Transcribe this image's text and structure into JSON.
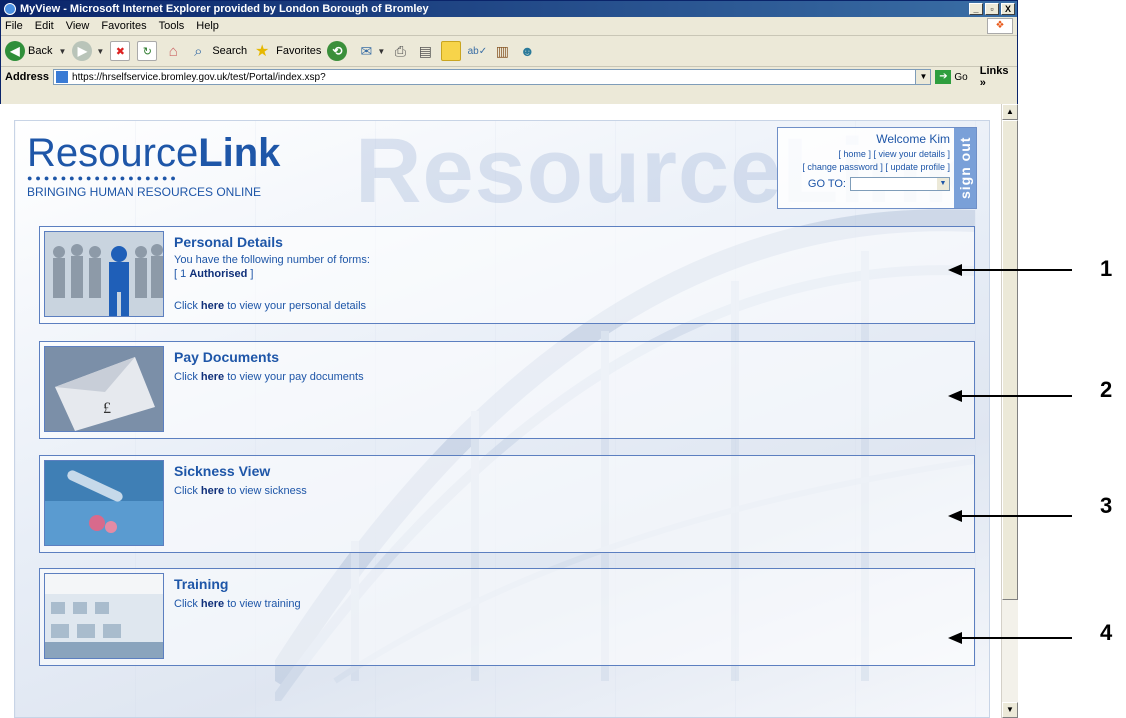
{
  "window": {
    "title": "MyView - Microsoft Internet Explorer provided by London Borough of Bromley",
    "min": "_",
    "max": "▫",
    "close": "X"
  },
  "menu": [
    "File",
    "Edit",
    "View",
    "Favorites",
    "Tools",
    "Help"
  ],
  "toolbar": {
    "back": "Back",
    "search": "Search",
    "favorites": "Favorites"
  },
  "address": {
    "label": "Address",
    "url": "https://hrselfservice.bromley.gov.uk/test/Portal/index.xsp?",
    "go": "Go",
    "links": "Links"
  },
  "header": {
    "watermark": "ResourceLink",
    "logo_text_a": "Resource",
    "logo_text_b": "Link",
    "tagline": "BRINGING HUMAN RESOURCES ONLINE"
  },
  "userbox": {
    "welcome": "Welcome Kim",
    "home": "home",
    "view_details": "view your details",
    "change_password": "change password",
    "update_profile": "update profile",
    "goto_label": "GO TO:",
    "signout": "sign out"
  },
  "panels": [
    {
      "title": "Personal Details",
      "line1": "You have the following number of forms:",
      "forms_count": "1",
      "forms_status": "Authorised",
      "click": "Click",
      "here": "here",
      "tail": "to view your personal details"
    },
    {
      "title": "Pay Documents",
      "click": "Click",
      "here": "here",
      "tail": "to view your pay documents"
    },
    {
      "title": "Sickness View",
      "click": "Click",
      "here": "here",
      "tail": "to view sickness"
    },
    {
      "title": "Training",
      "click": "Click",
      "here": "here",
      "tail": "to view training"
    }
  ],
  "annotations": [
    "1",
    "2",
    "3",
    "4"
  ]
}
